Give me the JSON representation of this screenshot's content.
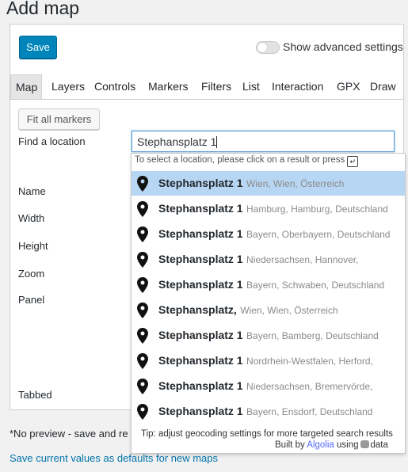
{
  "page": {
    "title": "Add map"
  },
  "toolbar": {
    "save_label": "Save",
    "advanced_label": "Show advanced settings"
  },
  "tabs": [
    "Map",
    "Layers",
    "Controls",
    "Markers",
    "Filters",
    "List",
    "Interaction",
    "GPX",
    "Draw"
  ],
  "fit_all_markers_label": "Fit all markers",
  "fields": {
    "find_location": "Find a location",
    "name": "Name",
    "width": "Width",
    "height": "Height",
    "zoom": "Zoom",
    "panel": "Panel",
    "tabbed": "Tabbed"
  },
  "search": {
    "value": "Stephansplatz 1"
  },
  "dropdown": {
    "hint": "To select a location, please click on a result or press",
    "results": [
      {
        "main": "Stephansplatz 1",
        "sub": "Wien, Wien, Österreich",
        "selected": true
      },
      {
        "main": "Stephansplatz 1",
        "sub": "Hamburg, Hamburg, Deutschland"
      },
      {
        "main": "Stephansplatz 1",
        "sub": "Bayern, Oberbayern, Deutschland"
      },
      {
        "main": "Stephansplatz 1",
        "sub": "Niedersachsen, Hannover,"
      },
      {
        "main": "Stephansplatz 1",
        "sub": "Bayern, Schwaben, Deutschland"
      },
      {
        "main": "Stephansplatz,",
        "sub": "Wien, Wien, Österreich"
      },
      {
        "main": "Stephansplatz 1",
        "sub": "Bayern, Bamberg, Deutschland"
      },
      {
        "main": "Stephansplatz 1",
        "sub": "Nordrhein-Westfalen, Herford,"
      },
      {
        "main": "Stephansplatz 1",
        "sub": "Niedersachsen, Bremervörde,"
      },
      {
        "main": "Stephansplatz 1",
        "sub": "Bayern, Ensdorf, Deutschland"
      }
    ],
    "tip": "Tip: adjust geocoding settings for more targeted search results",
    "built_by": "Built by",
    "algolia": "Algolia",
    "using": "using",
    "data": "data"
  },
  "no_preview": "*No preview - save and re",
  "defaults_link": "Save current values as defaults for new maps"
}
